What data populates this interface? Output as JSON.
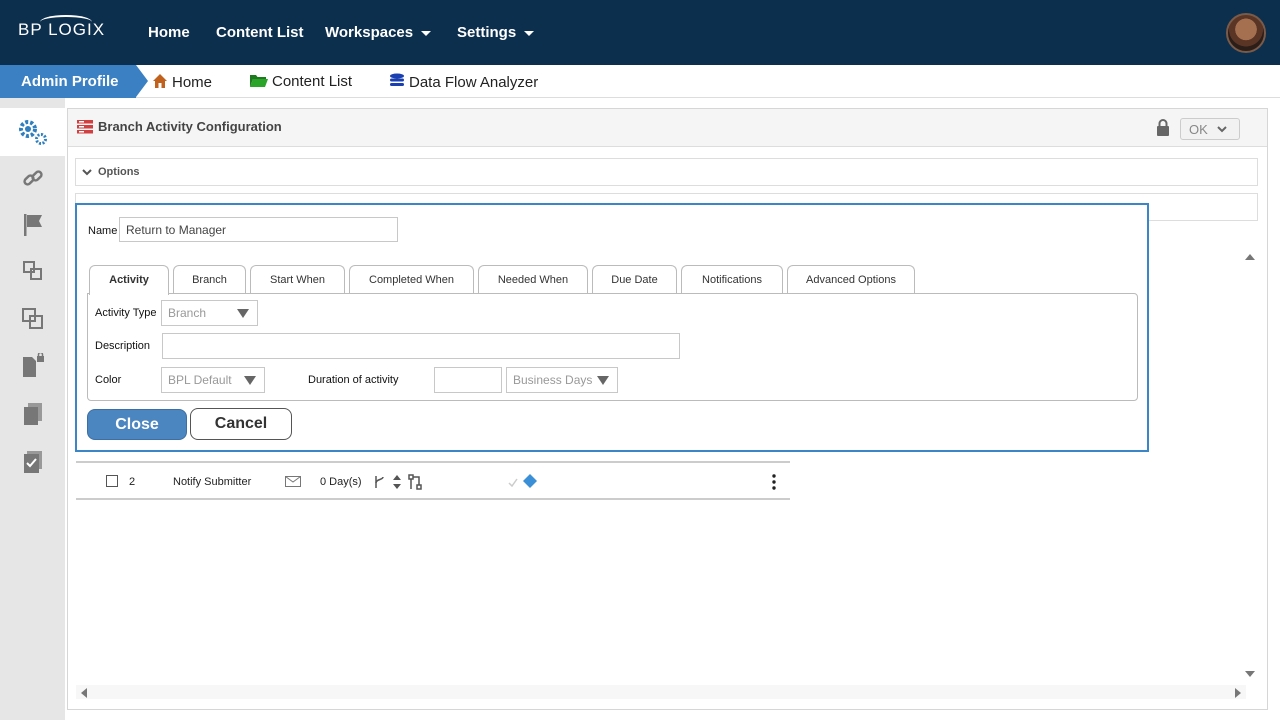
{
  "topnav": {
    "logo": "BP LOGIX",
    "items": [
      {
        "label": "Home"
      },
      {
        "label": "Content List"
      },
      {
        "label": "Workspaces"
      },
      {
        "label": "Settings"
      }
    ]
  },
  "breadcrumb": {
    "profile": "Admin Profile",
    "items": [
      {
        "label": "Home",
        "icon": "home-icon"
      },
      {
        "label": "Content List",
        "icon": "folder-icon"
      },
      {
        "label": "Data Flow Analyzer",
        "icon": "database-icon"
      }
    ]
  },
  "sidebar": {
    "icons": [
      "gears-icon",
      "link-icon",
      "flag-icon",
      "forms-icon",
      "copy-icon",
      "locked-file-icon",
      "documents-icon",
      "task-list-icon"
    ]
  },
  "panel": {
    "title": "Branch Activity Configuration",
    "ok_label": "OK",
    "options_label": "Options"
  },
  "grid": {
    "rows": [
      {
        "checked": false,
        "index": "2",
        "name": "Notify Submitter",
        "duration": "0 Day(s)"
      }
    ]
  },
  "dialog": {
    "name_label": "Name",
    "name_value": "Return to Manager",
    "tabs": [
      {
        "label": "Activity",
        "active": true
      },
      {
        "label": "Branch"
      },
      {
        "label": "Start When"
      },
      {
        "label": "Completed When"
      },
      {
        "label": "Needed When"
      },
      {
        "label": "Due Date"
      },
      {
        "label": "Notifications"
      },
      {
        "label": "Advanced Options"
      }
    ],
    "activity_type_label": "Activity Type",
    "activity_type_value": "Branch",
    "description_label": "Description",
    "description_value": "",
    "color_label": "Color",
    "color_value": "BPL Default",
    "duration_label": "Duration of activity",
    "duration_value": "",
    "duration_unit": "Business Days",
    "close_label": "Close",
    "cancel_label": "Cancel"
  },
  "colors": {
    "topbar": "#0c2f4e",
    "accent": "#3a80c3",
    "dialog_border": "#3a86c6",
    "close_button": "#4c86c0"
  }
}
